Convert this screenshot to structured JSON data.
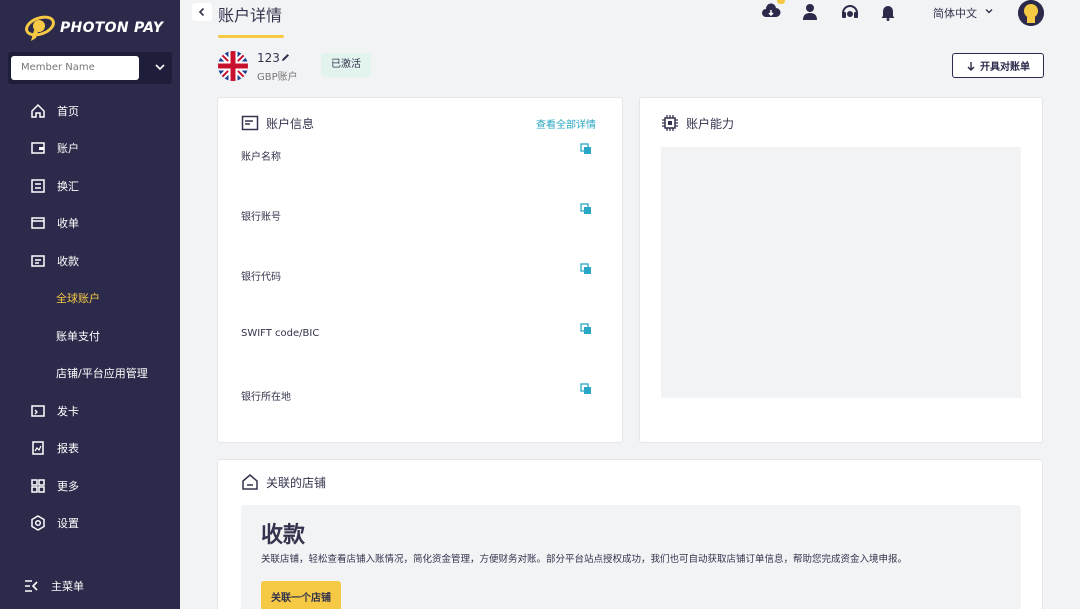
{
  "brand": {
    "name": "PHOTON PAY",
    "accent": "#f6c945",
    "sidebar_bg": "#2b2a4a",
    "link_color": "#2aa7c4"
  },
  "sidebar": {
    "member_placeholder": "Member Name",
    "items": [
      {
        "label": "首页",
        "icon": "home-icon"
      },
      {
        "label": "账户",
        "icon": "wallet-icon"
      },
      {
        "label": "换汇",
        "icon": "exchange-icon"
      },
      {
        "label": "收单",
        "icon": "receipt-icon"
      },
      {
        "label": "收款",
        "icon": "collection-icon"
      },
      {
        "label": "全球账户",
        "active": true
      },
      {
        "label": "账单支付"
      },
      {
        "label": "店铺/平台应用管理"
      },
      {
        "label": "发卡",
        "icon": "card-icon"
      },
      {
        "label": "报表",
        "icon": "report-icon"
      },
      {
        "label": "更多",
        "icon": "grid-icon"
      },
      {
        "label": "设置",
        "icon": "settings-icon"
      }
    ],
    "main_menu_label": "主菜单"
  },
  "header": {
    "title": "账户详情",
    "language": "简体中文"
  },
  "account": {
    "number": "123",
    "type": "GBP账户",
    "status": "已激活",
    "statement_button": "开具对账单"
  },
  "account_info": {
    "title": "账户信息",
    "view_all": "查看全部详情",
    "fields": [
      {
        "label": "账户名称"
      },
      {
        "label": "银行账号"
      },
      {
        "label": "银行代码"
      },
      {
        "label": "SWIFT code/BIC"
      },
      {
        "label": "银行所在地"
      }
    ]
  },
  "capability": {
    "title": "账户能力"
  },
  "linked_stores": {
    "title": "关联的店铺",
    "heading": "收款",
    "description": "关联店铺，轻松查看店铺入账情况，简化资金管理，方便财务对账。部分平台站点授权成功，我们也可自动获取店铺订单信息，帮助您完成资金入境申报。",
    "button": "关联一个店铺"
  }
}
